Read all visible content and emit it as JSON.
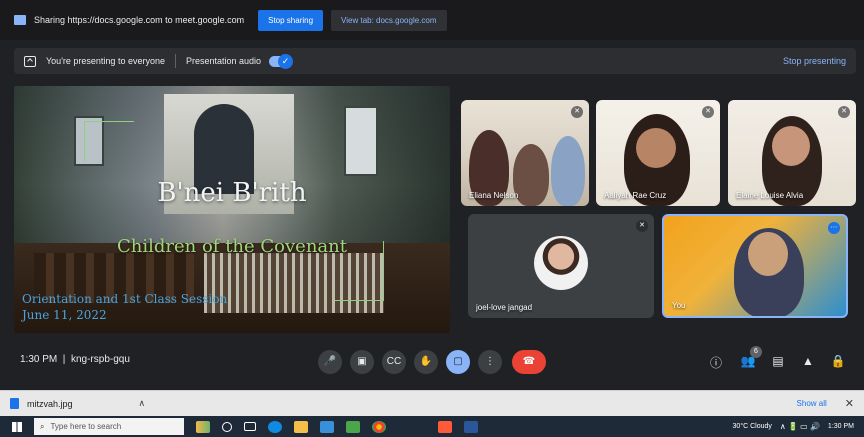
{
  "share_bar": {
    "text": "Sharing https://docs.google.com to meet.google.com",
    "stop_sharing": "Stop sharing",
    "view_tab": "View tab: docs.google.com"
  },
  "present_bar": {
    "text": "You're presenting to everyone",
    "audio_label": "Presentation audio",
    "stop_presenting": "Stop presenting"
  },
  "slide": {
    "title": "B'nei B'rith",
    "subtitle": "Children of the Covenant",
    "foot1": "Orientation and 1st Class Session",
    "foot2": "June 11, 2022"
  },
  "participants": [
    {
      "name": "Eliana Nelson",
      "muted": true
    },
    {
      "name": "Aaliyah Rae Cruz",
      "muted": true
    },
    {
      "name": "Elaine Louise Alvia",
      "muted": true
    },
    {
      "name": "joel-love jangad",
      "muted": true
    },
    {
      "name": "You",
      "muted": false
    }
  ],
  "controls": {
    "time": "1:30 PM",
    "meeting_code": "kng-rspb-gqu",
    "people_count": "6"
  },
  "download_bar": {
    "file_name": "mitzvah.jpg",
    "show_all": "Show all"
  },
  "taskbar": {
    "search_placeholder": "Type here to search",
    "weather": "30°C Cloudy",
    "clock": "1:30 PM"
  },
  "colors": {
    "meet_bg": "#202124",
    "accent_blue": "#1a73e8",
    "end_call_red": "#ea4335",
    "slide_green": "#9fd67c",
    "slide_blue": "#4aa3df"
  }
}
